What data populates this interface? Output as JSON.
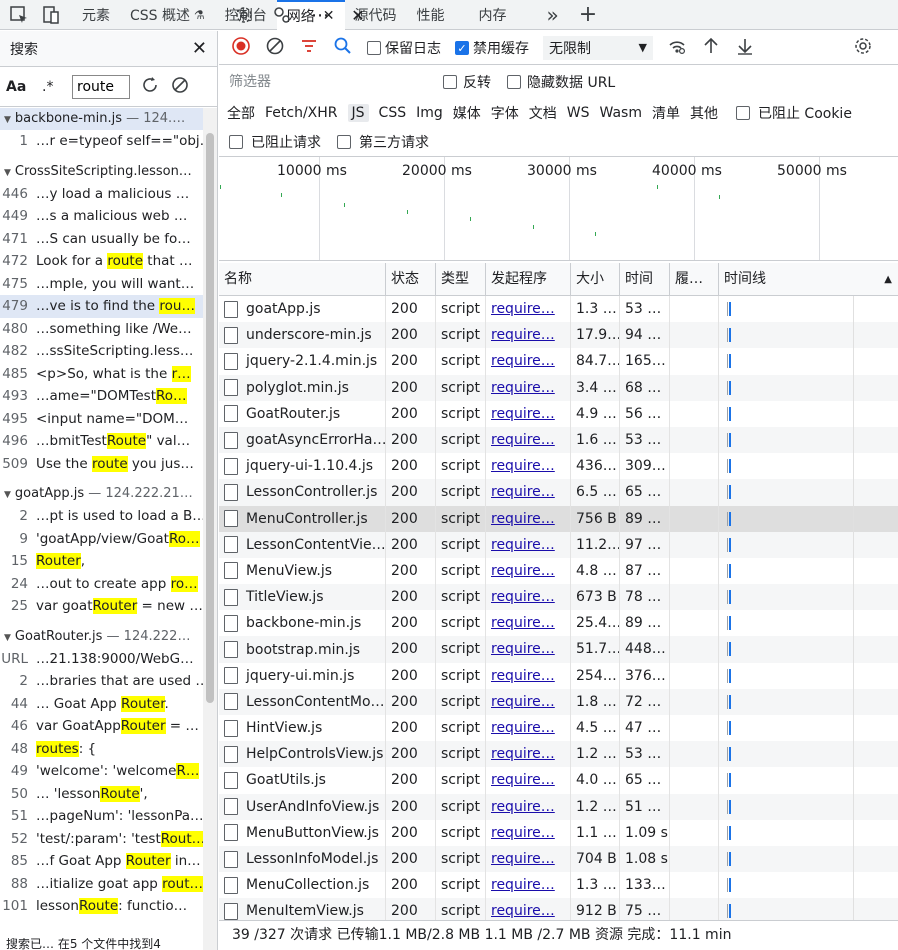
{
  "topbar": {
    "tabs": [
      {
        "label": "元素"
      },
      {
        "label": "CSS 概述"
      },
      {
        "label": "控制台"
      },
      {
        "label": "网络",
        "active": true
      },
      {
        "label": "源代码"
      },
      {
        "label": "性能"
      },
      {
        "label": "内存"
      }
    ],
    "close_glyph": "✕",
    "more_glyph": "»",
    "add_glyph": "+",
    "menu_glyph": "⋯",
    "close_devtools_glyph": "✕"
  },
  "search": {
    "title": "搜索",
    "close_glyph": "✕",
    "case_label": "Aa",
    "regex_label": ".*",
    "query": "route",
    "status": "搜索已… 在5 个文件中找到4",
    "files": [
      {
        "name": "backbone-min.js",
        "host": " — 124.…",
        "selected": true,
        "rows": [
          {
            "ln": "1",
            "pre": "…r e=typeof self==\"obj…",
            "hl": "",
            "post": ""
          }
        ]
      },
      {
        "name": "CrossSiteScripting.lesson…",
        "host": "",
        "rows": [
          {
            "ln": "446",
            "pre": "…y load a malicious …",
            "hl": "",
            "post": ""
          },
          {
            "ln": "449",
            "pre": "…s a  malicious web …",
            "hl": "",
            "post": ""
          },
          {
            "ln": "471",
            "pre": "…S can usually be fo…",
            "hl": "",
            "post": ""
          },
          {
            "ln": "472",
            "pre": "Look for a ",
            "hl": "route",
            "post": " that …"
          },
          {
            "ln": "475",
            "pre": "…mple, you will want…",
            "hl": "",
            "post": ""
          },
          {
            "ln": "479",
            "pre": "…ve is to find the ",
            "hl": "rou…",
            "post": "",
            "selected": true
          },
          {
            "ln": "480",
            "pre": "…something like /We…",
            "hl": "",
            "post": ""
          },
          {
            "ln": "482",
            "pre": "…ssSiteScripting.less…",
            "hl": "",
            "post": ""
          },
          {
            "ln": "485",
            "pre": "<p>So, what is the ",
            "hl": "r…",
            "post": ""
          },
          {
            "ln": "493",
            "pre": "…ame=\"DOMTest",
            "hl": "Ro…",
            "post": ""
          },
          {
            "ln": "495",
            "pre": "<input name=\"DOM…",
            "hl": "",
            "post": ""
          },
          {
            "ln": "496",
            "pre": "…bmitTest",
            "hl": "Route",
            "post": "\" val…"
          },
          {
            "ln": "509",
            "pre": "Use the ",
            "hl": "route",
            "post": " you jus…"
          }
        ]
      },
      {
        "name": "goatApp.js",
        "host": " — 124.222.21…",
        "rows": [
          {
            "ln": "2",
            "pre": "…pt is used to load a B…",
            "hl": "",
            "post": ""
          },
          {
            "ln": "9",
            "pre": "'goatApp/view/Goat",
            "hl": "Ro…",
            "post": ""
          },
          {
            "ln": "15",
            "pre": "",
            "hl": "Router",
            "post": ","
          },
          {
            "ln": "24",
            "pre": "…out to create app ",
            "hl": "ro…",
            "post": ""
          },
          {
            "ln": "25",
            "pre": "var goat",
            "hl": "Router",
            "post": " = new …"
          }
        ]
      },
      {
        "name": "GoatRouter.js",
        "host": " — 124.222…",
        "rows": [
          {
            "ln": "URL",
            "pre": "…21.138:9000/WebG…",
            "hl": "",
            "post": ""
          },
          {
            "ln": "2",
            "pre": "…braries that are used …",
            "hl": "",
            "post": ""
          },
          {
            "ln": "44",
            "pre": "… Goat App ",
            "hl": "Router",
            "post": "."
          },
          {
            "ln": "46",
            "pre": "var GoatApp",
            "hl": "Router",
            "post": " = …"
          },
          {
            "ln": "48",
            "pre": "",
            "hl": "routes",
            "post": ": {"
          },
          {
            "ln": "49",
            "pre": "'welcome': 'welcome",
            "hl": "R…",
            "post": ""
          },
          {
            "ln": "50",
            "pre": "… 'lesson",
            "hl": "Route",
            "post": "',"
          },
          {
            "ln": "51",
            "pre": "…pageNum': 'lessonPa…",
            "hl": "",
            "post": ""
          },
          {
            "ln": "52",
            "pre": "'test/:param': 'test",
            "hl": "Rout…",
            "post": ""
          },
          {
            "ln": "85",
            "pre": "…f Goat App ",
            "hl": "Router",
            "post": " in…"
          },
          {
            "ln": "88",
            "pre": "…itialize goat app ",
            "hl": "rout…",
            "post": ""
          },
          {
            "ln": "101",
            "pre": "lesson",
            "hl": "Route",
            "post": ": functio…"
          }
        ]
      }
    ]
  },
  "network": {
    "toolbar": {
      "preserve_log": "保留日志",
      "disable_cache": "禁用缓存",
      "throttle": "无限制"
    },
    "filter": {
      "placeholder": "筛选器",
      "invert": "反转",
      "hide_data_urls": "隐藏数据 URL",
      "types": [
        "全部",
        "Fetch/XHR",
        "JS",
        "CSS",
        "Img",
        "媒体",
        "字体",
        "文档",
        "WS",
        "Wasm",
        "清单",
        "其他"
      ],
      "active_type": "JS",
      "blocked_cookies": "已阻止 Cookie",
      "blocked_requests": "已阻止请求",
      "third_party": "第三方请求"
    },
    "overview_ticks": [
      "10000 ms",
      "20000 ms",
      "30000 ms",
      "40000 ms",
      "50000 ms"
    ],
    "columns": {
      "name": "名称",
      "status": "状态",
      "type": "类型",
      "initiator": "发起程序",
      "size": "大小",
      "time": "时间",
      "waterfall": "履…",
      "timeline": "时间线"
    },
    "rows": [
      {
        "name": "goatApp.js",
        "status": "200",
        "type": "script",
        "initiator": "require…",
        "size": "1.3 …",
        "time": "53 …"
      },
      {
        "name": "underscore-min.js",
        "status": "200",
        "type": "script",
        "initiator": "require…",
        "size": "17.9…",
        "time": "94 …"
      },
      {
        "name": "jquery-2.1.4.min.js",
        "status": "200",
        "type": "script",
        "initiator": "require…",
        "size": "84.7…",
        "time": "165…"
      },
      {
        "name": "polyglot.min.js",
        "status": "200",
        "type": "script",
        "initiator": "require…",
        "size": "3.4 …",
        "time": "68 …"
      },
      {
        "name": "GoatRouter.js",
        "status": "200",
        "type": "script",
        "initiator": "require…",
        "size": "4.9 …",
        "time": "56 …"
      },
      {
        "name": "goatAsyncErrorHa…",
        "status": "200",
        "type": "script",
        "initiator": "require…",
        "size": "1.6 …",
        "time": "53 …"
      },
      {
        "name": "jquery-ui-1.10.4.js",
        "status": "200",
        "type": "script",
        "initiator": "require…",
        "size": "436…",
        "time": "309…"
      },
      {
        "name": "LessonController.js",
        "status": "200",
        "type": "script",
        "initiator": "require…",
        "size": "6.5 …",
        "time": "65 …"
      },
      {
        "name": "MenuController.js",
        "status": "200",
        "type": "script",
        "initiator": "require…",
        "size": "756 B",
        "time": "89 …",
        "selected": true
      },
      {
        "name": "LessonContentVie…",
        "status": "200",
        "type": "script",
        "initiator": "require…",
        "size": "11.2…",
        "time": "97 …"
      },
      {
        "name": "MenuView.js",
        "status": "200",
        "type": "script",
        "initiator": "require…",
        "size": "4.8 …",
        "time": "87 …"
      },
      {
        "name": "TitleView.js",
        "status": "200",
        "type": "script",
        "initiator": "require…",
        "size": "673 B",
        "time": "78 …"
      },
      {
        "name": "backbone-min.js",
        "status": "200",
        "type": "script",
        "initiator": "require…",
        "size": "25.4…",
        "time": "89 …"
      },
      {
        "name": "bootstrap.min.js",
        "status": "200",
        "type": "script",
        "initiator": "require…",
        "size": "51.7…",
        "time": "448…"
      },
      {
        "name": "jquery-ui.min.js",
        "status": "200",
        "type": "script",
        "initiator": "require…",
        "size": "254…",
        "time": "376…"
      },
      {
        "name": "LessonContentMo…",
        "status": "200",
        "type": "script",
        "initiator": "require…",
        "size": "1.8 …",
        "time": "72 …"
      },
      {
        "name": "HintView.js",
        "status": "200",
        "type": "script",
        "initiator": "require…",
        "size": "4.5 …",
        "time": "47 …"
      },
      {
        "name": "HelpControlsView.js",
        "status": "200",
        "type": "script",
        "initiator": "require…",
        "size": "1.2 …",
        "time": "53 …"
      },
      {
        "name": "GoatUtils.js",
        "status": "200",
        "type": "script",
        "initiator": "require…",
        "size": "4.0 …",
        "time": "65 …"
      },
      {
        "name": "UserAndInfoView.js",
        "status": "200",
        "type": "script",
        "initiator": "require…",
        "size": "1.2 …",
        "time": "51 …"
      },
      {
        "name": "MenuButtonView.js",
        "status": "200",
        "type": "script",
        "initiator": "require…",
        "size": "1.1 …",
        "time": "1.09 s"
      },
      {
        "name": "LessonInfoModel.js",
        "status": "200",
        "type": "script",
        "initiator": "require…",
        "size": "704 B",
        "time": "1.08 s"
      },
      {
        "name": "MenuCollection.js",
        "status": "200",
        "type": "script",
        "initiator": "require…",
        "size": "1.3 …",
        "time": "133…"
      },
      {
        "name": "MenuItemView.js",
        "status": "200",
        "type": "script",
        "initiator": "require…",
        "size": "912 B",
        "time": "75 …"
      }
    ],
    "status_bar": "39 /327 次请求  已传输1.1 MB/2.8 MB  1.1 MB /2.7 MB 资源  完成：11.1 min"
  }
}
